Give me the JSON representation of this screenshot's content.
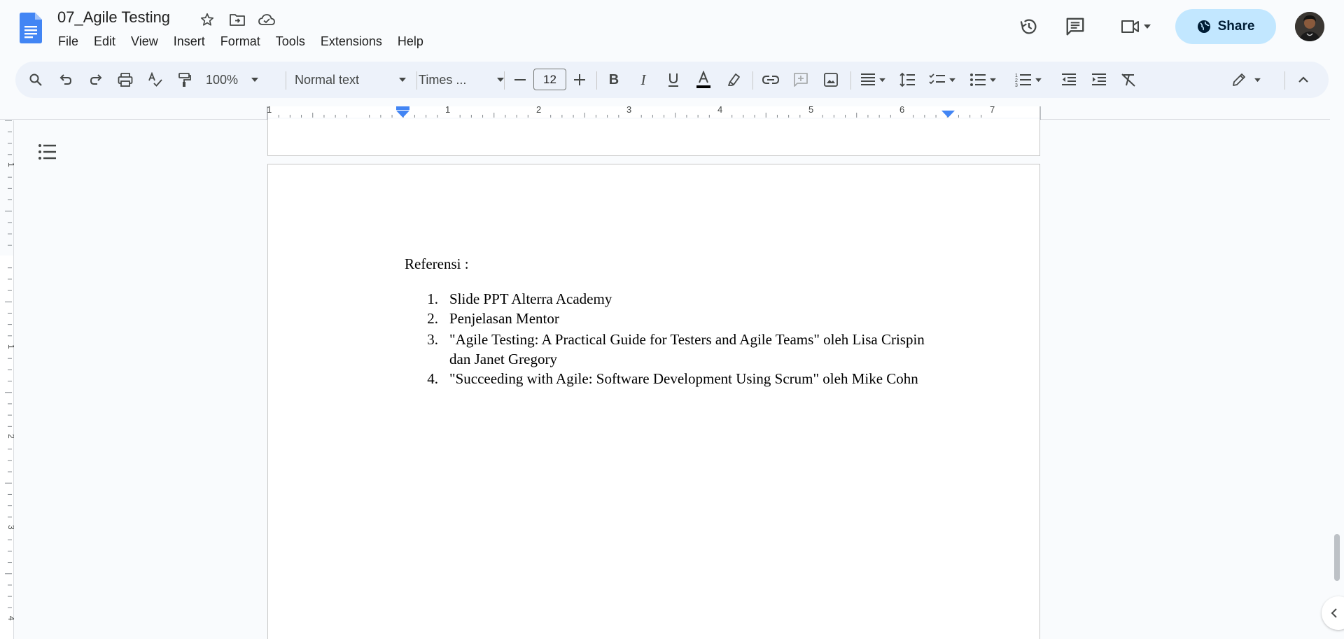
{
  "doc": {
    "title": "07_Agile Testing",
    "menu": [
      "File",
      "Edit",
      "View",
      "Insert",
      "Format",
      "Tools",
      "Extensions",
      "Help"
    ]
  },
  "header": {
    "share_label": "Share",
    "icons": [
      "history-icon",
      "comment-icon",
      "meet-icon",
      "globe-icon"
    ]
  },
  "toolbar": {
    "zoom": "100%",
    "style": "Normal text",
    "font": "Times ...",
    "font_size": "12",
    "text_color": "#000000",
    "accent": "#c2e7ff"
  },
  "ruler": {
    "top_labels": [
      "1",
      "1",
      "2",
      "3",
      "4",
      "5",
      "6",
      "7"
    ],
    "left_labels": [
      "1",
      "1",
      "2",
      "3",
      "4"
    ]
  },
  "content": {
    "heading": "Referensi :",
    "references": [
      {
        "num": "1.",
        "lines": [
          "Slide PPT Alterra Academy"
        ]
      },
      {
        "num": "2.",
        "lines": [
          "Penjelasan Mentor"
        ]
      },
      {
        "num": "3.",
        "lines": [
          "\"Agile Testing: A Practical Guide for Testers and Agile Teams\" oleh Lisa Crispin",
          "dan Janet Gregory"
        ]
      },
      {
        "num": "4.",
        "lines": [
          "\"Succeeding with Agile: Software Development Using Scrum\" oleh Mike Cohn"
        ]
      }
    ]
  }
}
